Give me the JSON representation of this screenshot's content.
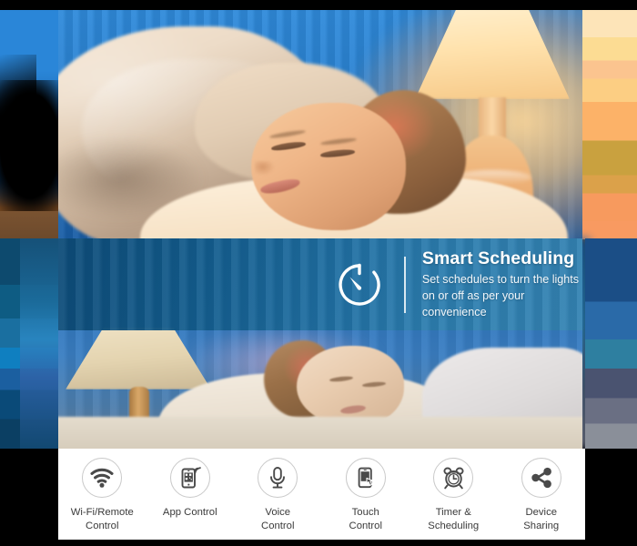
{
  "banner": {
    "icon": "stopwatch-timer-icon",
    "title": "Smart Scheduling",
    "subtitle_line1": "Set schedules to turn the lights",
    "subtitle_line2": "on or off as per your convenience",
    "accent_color": "#1d6a9e",
    "text_color": "#ffffff"
  },
  "photos": [
    {
      "name": "child-sleeping-warm-lamp",
      "alt": "Child sleeping in bed lit by a warm bedside lamp against a blue curtain"
    },
    {
      "name": "child-sleeping-cool-lamp",
      "alt": "Child sleeping beside a lit table lamp in a blue-toned room"
    }
  ],
  "features": {
    "panel_bg": "#ffffff",
    "icon_color": "#4a4a4a",
    "items": [
      {
        "icon": "wifi-icon",
        "label": "Wi-Fi/Remote\nControl"
      },
      {
        "icon": "smartphone-app-icon",
        "label": "App Control"
      },
      {
        "icon": "microphone-icon",
        "label": "Voice\nControl"
      },
      {
        "icon": "touch-phone-icon",
        "label": "Touch\nControl"
      },
      {
        "icon": "alarm-clock-icon",
        "label": "Timer &\nScheduling"
      },
      {
        "icon": "share-nodes-icon",
        "label": "Device\nSharing"
      }
    ]
  }
}
